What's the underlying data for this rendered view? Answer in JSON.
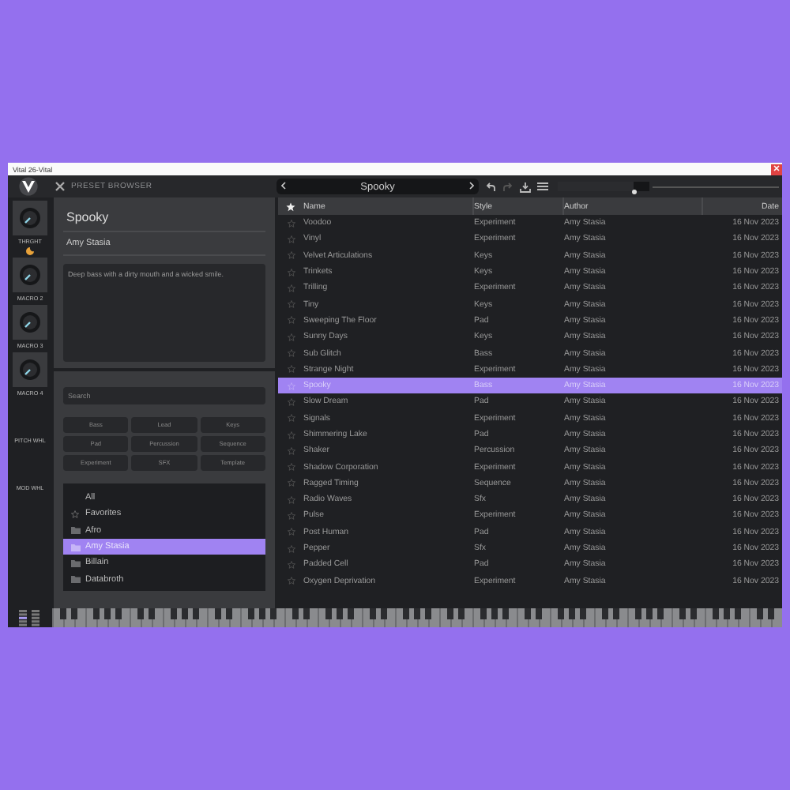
{
  "window": {
    "title": "Vital 26-Vital"
  },
  "header": {
    "title": "PRESET BROWSER",
    "preset": "Spooky",
    "volume": {
      "level": 0.83
    }
  },
  "macros": [
    {
      "label": "THRGHT",
      "kind": "knob"
    },
    {
      "label": "MACRO 2",
      "kind": "knob"
    },
    {
      "label": "MACRO 3",
      "kind": "knob"
    },
    {
      "label": "MACRO 4",
      "kind": "knob"
    },
    {
      "label": "PITCH WHL",
      "kind": "wheel"
    },
    {
      "label": "MOD WHL",
      "kind": "wheel"
    }
  ],
  "preset": {
    "name": "Spooky",
    "author": "Amy Stasia",
    "description": "Deep bass with a dirty mouth and a wicked smile."
  },
  "search": {
    "placeholder": "Search"
  },
  "styles": [
    "Bass",
    "Lead",
    "Keys",
    "Pad",
    "Percussion",
    "Sequence",
    "Experiment",
    "SFX",
    "Template"
  ],
  "folders": [
    {
      "label": "All",
      "kind": "all",
      "selected": false
    },
    {
      "label": "Favorites",
      "kind": "favorites",
      "selected": false
    },
    {
      "label": "Afro",
      "kind": "folder",
      "selected": false
    },
    {
      "label": "Amy Stasia",
      "kind": "folder",
      "selected": true
    },
    {
      "label": "Billain",
      "kind": "folder",
      "selected": false
    },
    {
      "label": "Databroth",
      "kind": "folder",
      "selected": false
    }
  ],
  "table": {
    "columns": [
      "Name",
      "Style",
      "Author",
      "Date"
    ],
    "rows": [
      {
        "name": "Voodoo",
        "style": "Experiment",
        "author": "Amy Stasia",
        "date": "16 Nov 2023",
        "favorite": false,
        "selected": false
      },
      {
        "name": "Vinyl",
        "style": "Experiment",
        "author": "Amy Stasia",
        "date": "16 Nov 2023",
        "favorite": false,
        "selected": false
      },
      {
        "name": "Velvet Articulations",
        "style": "Keys",
        "author": "Amy Stasia",
        "date": "16 Nov 2023",
        "favorite": false,
        "selected": false
      },
      {
        "name": "Trinkets",
        "style": "Keys",
        "author": "Amy Stasia",
        "date": "16 Nov 2023",
        "favorite": false,
        "selected": false
      },
      {
        "name": "Trilling",
        "style": "Experiment",
        "author": "Amy Stasia",
        "date": "16 Nov 2023",
        "favorite": false,
        "selected": false
      },
      {
        "name": "Tiny",
        "style": "Keys",
        "author": "Amy Stasia",
        "date": "16 Nov 2023",
        "favorite": false,
        "selected": false
      },
      {
        "name": "Sweeping The Floor",
        "style": "Pad",
        "author": "Amy Stasia",
        "date": "16 Nov 2023",
        "favorite": false,
        "selected": false
      },
      {
        "name": "Sunny Days",
        "style": "Keys",
        "author": "Amy Stasia",
        "date": "16 Nov 2023",
        "favorite": false,
        "selected": false
      },
      {
        "name": "Sub Glitch",
        "style": "Bass",
        "author": "Amy Stasia",
        "date": "16 Nov 2023",
        "favorite": false,
        "selected": false
      },
      {
        "name": "Strange Night",
        "style": "Experiment",
        "author": "Amy Stasia",
        "date": "16 Nov 2023",
        "favorite": false,
        "selected": false
      },
      {
        "name": "Spooky",
        "style": "Bass",
        "author": "Amy Stasia",
        "date": "16 Nov 2023",
        "favorite": false,
        "selected": true
      },
      {
        "name": "Slow Dream",
        "style": "Pad",
        "author": "Amy Stasia",
        "date": "16 Nov 2023",
        "favorite": false,
        "selected": false
      },
      {
        "name": "Signals",
        "style": "Experiment",
        "author": "Amy Stasia",
        "date": "16 Nov 2023",
        "favorite": false,
        "selected": false
      },
      {
        "name": "Shimmering Lake",
        "style": "Pad",
        "author": "Amy Stasia",
        "date": "16 Nov 2023",
        "favorite": false,
        "selected": false
      },
      {
        "name": "Shaker",
        "style": "Percussion",
        "author": "Amy Stasia",
        "date": "16 Nov 2023",
        "favorite": false,
        "selected": false
      },
      {
        "name": "Shadow Corporation",
        "style": "Experiment",
        "author": "Amy Stasia",
        "date": "16 Nov 2023",
        "favorite": false,
        "selected": false
      },
      {
        "name": "Ragged Timing",
        "style": "Sequence",
        "author": "Amy Stasia",
        "date": "16 Nov 2023",
        "favorite": false,
        "selected": false
      },
      {
        "name": "Radio Waves",
        "style": "Sfx",
        "author": "Amy Stasia",
        "date": "16 Nov 2023",
        "favorite": false,
        "selected": false
      },
      {
        "name": "Pulse",
        "style": "Experiment",
        "author": "Amy Stasia",
        "date": "16 Nov 2023",
        "favorite": false,
        "selected": false
      },
      {
        "name": "Post Human",
        "style": "Pad",
        "author": "Amy Stasia",
        "date": "16 Nov 2023",
        "favorite": false,
        "selected": false
      },
      {
        "name": "Pepper",
        "style": "Sfx",
        "author": "Amy Stasia",
        "date": "16 Nov 2023",
        "favorite": false,
        "selected": false
      },
      {
        "name": "Padded Cell",
        "style": "Pad",
        "author": "Amy Stasia",
        "date": "16 Nov 2023",
        "favorite": false,
        "selected": false
      },
      {
        "name": "Oxygen Deprivation",
        "style": "Experiment",
        "author": "Amy Stasia",
        "date": "16 Nov 2023",
        "favorite": false,
        "selected": false
      }
    ]
  }
}
